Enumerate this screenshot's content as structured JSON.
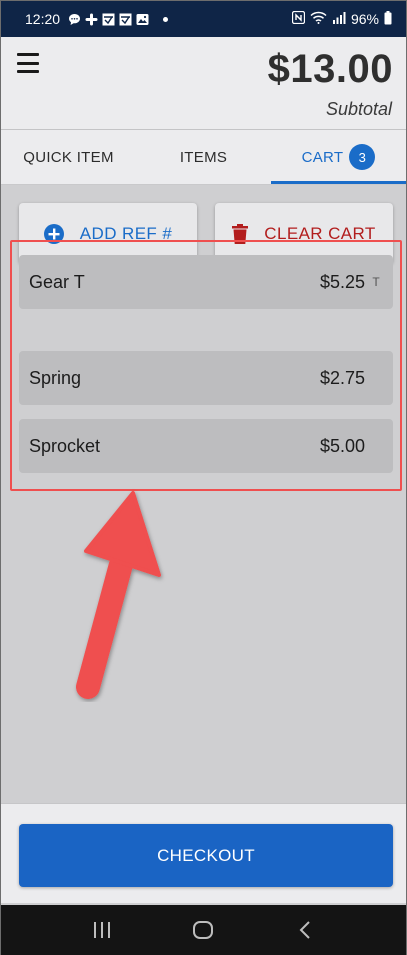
{
  "status_bar": {
    "time": "12:20",
    "battery": "96%",
    "notification_icons": [
      "chat-bubble-icon",
      "slack-icon",
      "app-icon",
      "app-icon",
      "image-icon",
      "dot-icon"
    ],
    "system_icons": [
      "nfc-icon",
      "wifi-icon",
      "signal-icon",
      "battery-icon"
    ]
  },
  "header": {
    "menu_icon": "hamburger-menu-icon",
    "subtotal_amount": "$13.00",
    "subtotal_label": "Subtotal"
  },
  "tabs": [
    {
      "label": "QUICK ITEM",
      "active": false
    },
    {
      "label": "ITEMS",
      "active": false
    },
    {
      "label": "CART",
      "active": true,
      "badge": "3"
    }
  ],
  "actions": {
    "add_ref_label": "ADD REF #",
    "add_ref_icon": "plus-circle-icon",
    "clear_cart_label": "CLEAR CART",
    "clear_cart_icon": "trash-icon"
  },
  "cart": {
    "items": [
      {
        "name": "Gear T",
        "price": "$5.25",
        "tax_flag": "T"
      },
      {
        "name": "Spring",
        "price": "$2.75",
        "tax_flag": ""
      },
      {
        "name": "Sprocket",
        "price": "$5.00",
        "tax_flag": ""
      }
    ]
  },
  "footer": {
    "checkout_label": "CHECKOUT"
  },
  "nav_bar": {
    "buttons": [
      "recent-apps-icon",
      "home-icon",
      "back-icon"
    ]
  },
  "colors": {
    "accent": "#1a6cc8",
    "danger": "#b21d1d",
    "annotation": "#ef4f4f",
    "status_bar": "#0f2547"
  }
}
